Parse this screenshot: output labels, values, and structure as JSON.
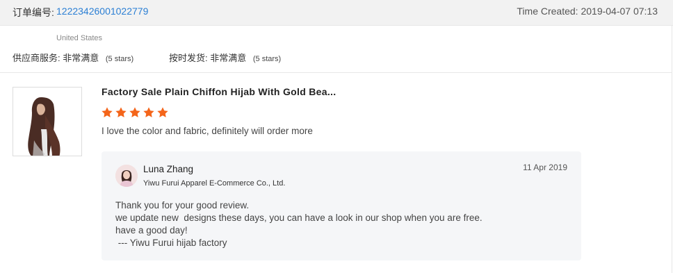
{
  "header": {
    "order_label": "订单编号:",
    "order_number": "12223426001022779",
    "time_created": "Time Created: 2019-04-07 07:13"
  },
  "buyer": {
    "country": "United States"
  },
  "ratings": [
    {
      "label": "供应商服务: 非常满意",
      "stars_text": "(5 stars)"
    },
    {
      "label": "按时发货: 非常满意",
      "stars_text": "(5 stars)"
    }
  ],
  "review": {
    "product_title": "Factory Sale Plain Chiffon Hijab With Gold Bea...",
    "star_count": 5,
    "star_color": "#f4651a",
    "text": "I love the color and fabric, definitely will order more"
  },
  "reply": {
    "name": "Luna Zhang",
    "company": "Yiwu Furui Apparel E-Commerce Co., Ltd.",
    "date": "11 Apr 2019",
    "lines": [
      "Thank you for your good review.",
      "we update new  designs these days, you can have a look in our shop when you are free.",
      "have a good day!",
      " --- Yiwu Furui hijab factory"
    ]
  },
  "colors": {
    "link": "#2b7fd4",
    "header_bg": "#f2f2f2",
    "reply_bg": "#f5f6f8"
  }
}
